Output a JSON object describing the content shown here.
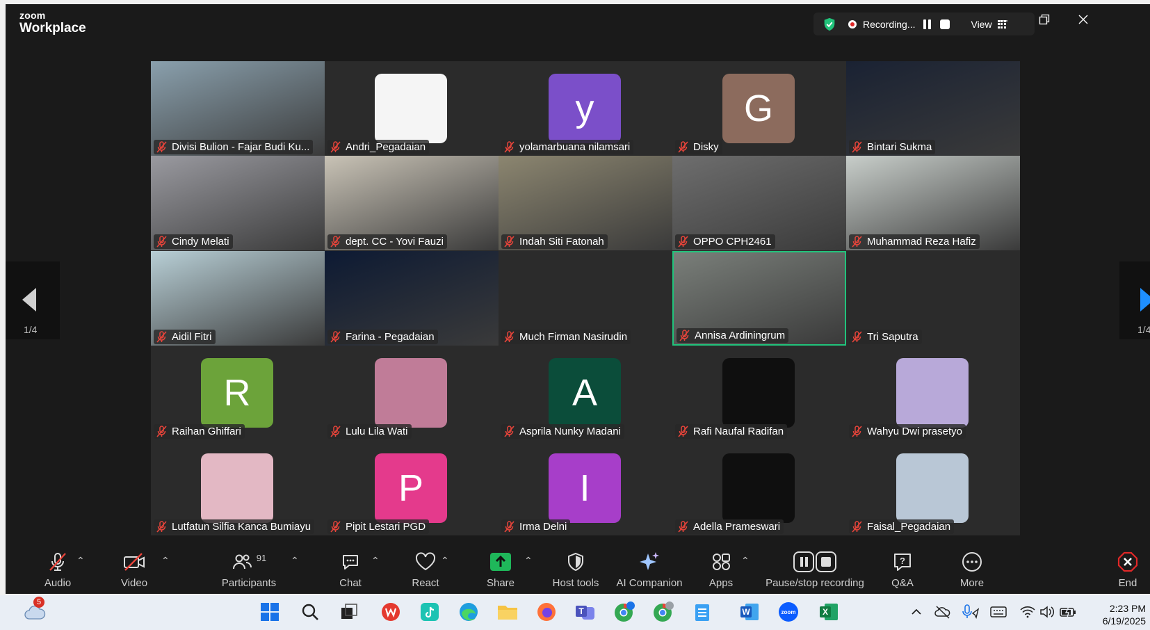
{
  "app": {
    "brand_small": "zoom",
    "brand_large": "Workplace"
  },
  "recording": {
    "status": "Recording...",
    "view_label": "View"
  },
  "pager": {
    "left_count": "1/4",
    "right_count": "1/4"
  },
  "participants": [
    {
      "name": "Divisi Bulion - Fajar Budi Ku...",
      "kind": "video",
      "bg": "#8aa0ad"
    },
    {
      "name": "Andri_Pegadaian",
      "kind": "avatar",
      "letter": "",
      "color": "#f5f5f5"
    },
    {
      "name": "yolamarbuana nilamsari",
      "kind": "avatar",
      "letter": "y",
      "color": "#7b4fc9"
    },
    {
      "name": "Disky",
      "kind": "avatar",
      "letter": "G",
      "color": "#8c6b5d"
    },
    {
      "name": "Bintari Sukma",
      "kind": "video",
      "bg": "#1a2233"
    },
    {
      "name": "Cindy Melati",
      "kind": "video",
      "bg": "#9a9aa0"
    },
    {
      "name": "dept. CC - Yovi Fauzi",
      "kind": "video",
      "bg": "#c9c3b6"
    },
    {
      "name": "Indah Siti Fatonah",
      "kind": "video",
      "bg": "#8c8670"
    },
    {
      "name": "OPPO CPH2461",
      "kind": "video",
      "bg": "#6e6e6e"
    },
    {
      "name": "Muhammad Reza Hafiz",
      "kind": "video",
      "bg": "#c8ceca"
    },
    {
      "name": "Aidil Fitri",
      "kind": "video",
      "bg": "#b8cfd6"
    },
    {
      "name": "Farina - Pegadaian",
      "kind": "video",
      "bg": "#0d1a33"
    },
    {
      "name": "Much Firman Nasirudin",
      "kind": "blank"
    },
    {
      "name": "Annisa Ardiningrum",
      "kind": "video",
      "bg": "#7a7f7a",
      "active": true
    },
    {
      "name": "Tri Saputra",
      "kind": "blank"
    },
    {
      "name": "Raihan Ghiffari",
      "kind": "avatar",
      "letter": "R",
      "color": "#6ca33a"
    },
    {
      "name": "Lulu Lila Wati",
      "kind": "avatar",
      "letter": "",
      "color": "#c07c98"
    },
    {
      "name": "Asprila Nunky Madani",
      "kind": "avatar",
      "letter": "A",
      "color": "#0b4d3a"
    },
    {
      "name": "Rafi Naufal Radifan",
      "kind": "avatar",
      "letter": "",
      "color": "#0f0f0f"
    },
    {
      "name": "Wahyu Dwi prasetyo",
      "kind": "avatar",
      "letter": "",
      "color": "#b8a9d9"
    },
    {
      "name": "Lutfatun Silfia Kanca Bumiayu",
      "kind": "avatar",
      "letter": "",
      "color": "#e3b8c4"
    },
    {
      "name": "Pipit Lestari PGD",
      "kind": "avatar",
      "letter": "P",
      "color": "#e43a8c"
    },
    {
      "name": "Irma Delni",
      "kind": "avatar",
      "letter": "I",
      "color": "#a73ec9"
    },
    {
      "name": "Adella Prameswari",
      "kind": "avatar",
      "letter": "",
      "color": "#0f0f0f"
    },
    {
      "name": "Faisal_Pegadaian",
      "kind": "avatar",
      "letter": "",
      "color": "#b9c7d6"
    }
  ],
  "toolbar": {
    "audio": "Audio",
    "video": "Video",
    "participants": "Participants",
    "participants_count": "91",
    "chat": "Chat",
    "react": "React",
    "share": "Share",
    "host_tools": "Host tools",
    "ai_companion": "AI Companion",
    "apps": "Apps",
    "pause_stop_recording": "Pause/stop recording",
    "qa": "Q&A",
    "more": "More",
    "end": "End"
  },
  "taskbar": {
    "weather_badge": "5",
    "time": "2:23 PM",
    "date": "6/19/2025"
  },
  "colors": {
    "accent_green": "#21c37b",
    "mute_red": "#e8443a",
    "share_green": "#1fb75a",
    "end_red": "#e02828"
  }
}
